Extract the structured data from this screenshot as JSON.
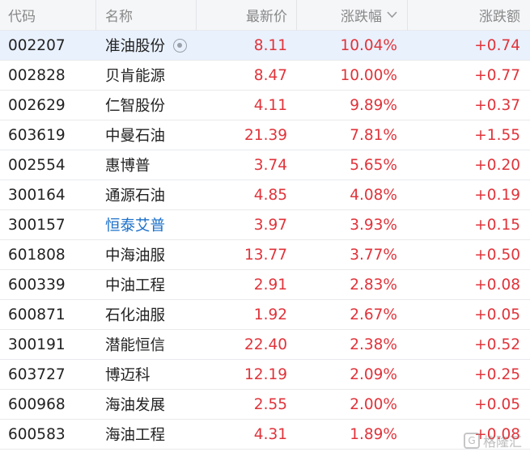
{
  "header": {
    "code": "代码",
    "name": "名称",
    "price": "最新价",
    "pct": "涨跌幅",
    "chg": "涨跌额",
    "sort_icon": "chevron-down-icon"
  },
  "rows": [
    {
      "code": "002207",
      "name": "准油股份",
      "price": "8.11",
      "pct": "10.04%",
      "chg": "+0.74"
    },
    {
      "code": "002828",
      "name": "贝肯能源",
      "price": "8.47",
      "pct": "10.00%",
      "chg": "+0.77"
    },
    {
      "code": "002629",
      "name": "仁智股份",
      "price": "4.11",
      "pct": "9.89%",
      "chg": "+0.37"
    },
    {
      "code": "603619",
      "name": "中曼石油",
      "price": "21.39",
      "pct": "7.81%",
      "chg": "+1.55"
    },
    {
      "code": "002554",
      "name": "惠博普",
      "price": "3.74",
      "pct": "5.65%",
      "chg": "+0.20"
    },
    {
      "code": "300164",
      "name": "通源石油",
      "price": "4.85",
      "pct": "4.08%",
      "chg": "+0.19"
    },
    {
      "code": "300157",
      "name": "恒泰艾普",
      "price": "3.97",
      "pct": "3.93%",
      "chg": "+0.15"
    },
    {
      "code": "601808",
      "name": "中海油服",
      "price": "13.77",
      "pct": "3.77%",
      "chg": "+0.50"
    },
    {
      "code": "600339",
      "name": "中油工程",
      "price": "2.91",
      "pct": "2.83%",
      "chg": "+0.08"
    },
    {
      "code": "600871",
      "name": "石化油服",
      "price": "1.92",
      "pct": "2.67%",
      "chg": "+0.05"
    },
    {
      "code": "300191",
      "name": "潜能恒信",
      "price": "22.40",
      "pct": "2.38%",
      "chg": "+0.52"
    },
    {
      "code": "603727",
      "name": "博迈科",
      "price": "12.19",
      "pct": "2.09%",
      "chg": "+0.25"
    },
    {
      "code": "600968",
      "name": "海油发展",
      "price": "2.55",
      "pct": "2.00%",
      "chg": "+0.05"
    },
    {
      "code": "600583",
      "name": "海油工程",
      "price": "4.31",
      "pct": "1.89%",
      "chg": "+0.08"
    }
  ],
  "watermark": {
    "text": "格隆汇"
  },
  "colors": {
    "up": "#e0333a",
    "link": "#1a6fc9",
    "selected_bg": "#e9f1fd",
    "header_bg": "#f5f6f8"
  }
}
